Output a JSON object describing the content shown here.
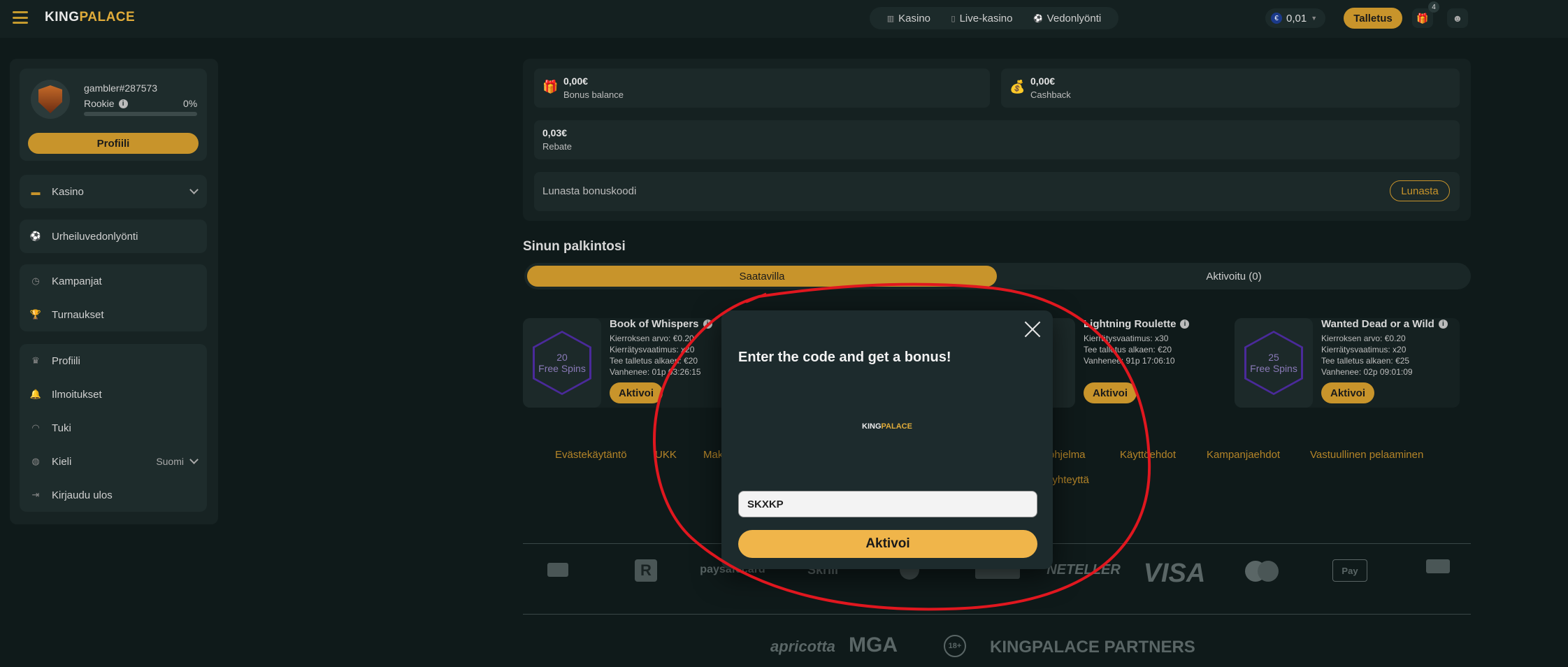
{
  "header": {
    "logo_king": "KING",
    "logo_palace": "PALACE",
    "nav": [
      {
        "label": "Kasino",
        "icon": "slot-icon"
      },
      {
        "label": "Live-kasino",
        "icon": "card-icon"
      },
      {
        "label": "Vedonlyönti",
        "icon": "ball-icon"
      }
    ],
    "currency_symbol": "€",
    "balance": "0,01",
    "deposit_label": "Talletus",
    "gift_badge_count": "4"
  },
  "sidebar": {
    "username": "gambler#287573",
    "rank": "Rookie",
    "progress_pct": "0%",
    "progress_fraction": 0,
    "profile_button": "Profiili",
    "group1": [
      {
        "label": "Kasino",
        "icon": "slot-icon"
      }
    ],
    "group2": [
      {
        "label": "Urheiluvedonlyönti",
        "icon": "ball-icon"
      }
    ],
    "group3": [
      {
        "label": "Kampanjat",
        "icon": "clock-icon"
      },
      {
        "label": "Turnaukset",
        "icon": "trophy-icon"
      }
    ],
    "group4": [
      {
        "label": "Profiili",
        "icon": "crown-icon"
      },
      {
        "label": "Ilmoitukset",
        "icon": "bell-icon"
      },
      {
        "label": "Tuki",
        "icon": "headset-icon"
      },
      {
        "label": "Kieli",
        "icon": "globe-icon",
        "value": "Suomi"
      },
      {
        "label": "Kirjaudu ulos",
        "icon": "logout-icon"
      }
    ]
  },
  "bonus": {
    "bonus_balance_value": "0,00€",
    "bonus_balance_label": "Bonus balance",
    "cashback_value": "0,00€",
    "cashback_label": "Cashback",
    "rebate_value": "0,03€",
    "rebate_label": "Rebate",
    "redeem_label": "Lunasta bonuskoodi",
    "redeem_button": "Lunasta"
  },
  "rewards": {
    "title": "Sinun palkintosi",
    "tab_available": "Saatavilla",
    "tab_activated": "Aktivoitu (0)",
    "cards": [
      {
        "spins_count": "20",
        "spins_label": "Free Spins",
        "title": "Book of Whispers",
        "lines": [
          "Kierroksen arvo:  €0.20",
          "Kierrätysvaatimus:  x20",
          "Tee talletus alkaen:  €20",
          "Vanhenee:  01p  03:26:15"
        ],
        "button": "Aktivoi"
      },
      {
        "spins_count": "",
        "spins_label": "",
        "title": "Lightning Roulette",
        "lines": [
          "Kierrätysvaatimus:  x30",
          "Tee talletus alkaen:  €20",
          "Vanhenee:  91p  17:06:10"
        ],
        "button": "Aktivoi"
      },
      {
        "spins_count": "25",
        "spins_label": "Free Spins",
        "title": "Wanted Dead or a Wild",
        "lines": [
          "Kierroksen arvo:  €0.20",
          "Kierrätysvaatimus:  x20",
          "Tee talletus alkaen:  €25",
          "Vanhenee:  02p  09:01:09"
        ],
        "button": "Aktivoi"
      }
    ]
  },
  "footer": {
    "links": [
      "Evästekäytäntö",
      "UKK",
      "Mak",
      "ohjelma",
      "Käyttöehdot",
      "Kampanjaehdot",
      "Vastuullinen pelaaminen"
    ],
    "link_row2": "ota meihin yhteyttä",
    "payments": [
      "paysafecard",
      "Skrill",
      "NETELLER",
      "VISA"
    ],
    "bottom": [
      "apricotta",
      "MGA",
      "18+",
      "KINGPALACE PARTNERS"
    ]
  },
  "modal": {
    "title": "Enter the code and get a bonus!",
    "logo_king": "KING",
    "logo_palace": "PALACE",
    "input_value": "SKXKP",
    "button": "Aktivoi"
  }
}
